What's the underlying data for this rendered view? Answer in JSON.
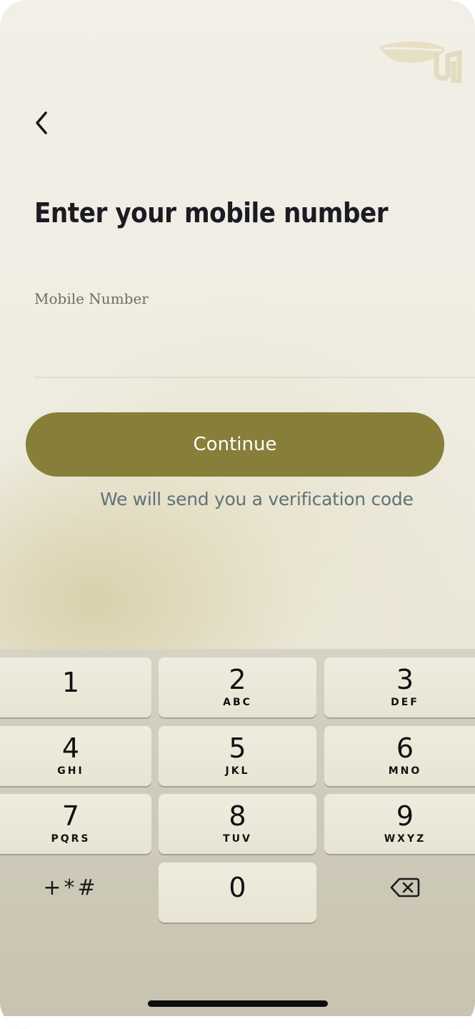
{
  "header": {
    "back_icon": "chevron-left-icon",
    "logo_icon": "leaf-logo-icon"
  },
  "page": {
    "title": "Enter your mobile number"
  },
  "mobile_field": {
    "label": "Mobile Number",
    "value": ""
  },
  "actions": {
    "continue_label": "Continue",
    "hint": "We will send you a verification code"
  },
  "keyboard": {
    "keys": [
      {
        "digit": "1",
        "letters": ""
      },
      {
        "digit": "2",
        "letters": "ABC"
      },
      {
        "digit": "3",
        "letters": "DEF"
      },
      {
        "digit": "4",
        "letters": "GHI"
      },
      {
        "digit": "5",
        "letters": "JKL"
      },
      {
        "digit": "6",
        "letters": "MNO"
      },
      {
        "digit": "7",
        "letters": "PQRS"
      },
      {
        "digit": "8",
        "letters": "TUV"
      },
      {
        "digit": "9",
        "letters": "WXYZ"
      },
      {
        "digit": "0",
        "letters": ""
      }
    ],
    "symbols_label": "+*#",
    "delete_icon": "backspace-icon"
  },
  "colors": {
    "accent": "#877e39",
    "hint_text": "#5f7179",
    "title_text": "#1c1a22"
  }
}
